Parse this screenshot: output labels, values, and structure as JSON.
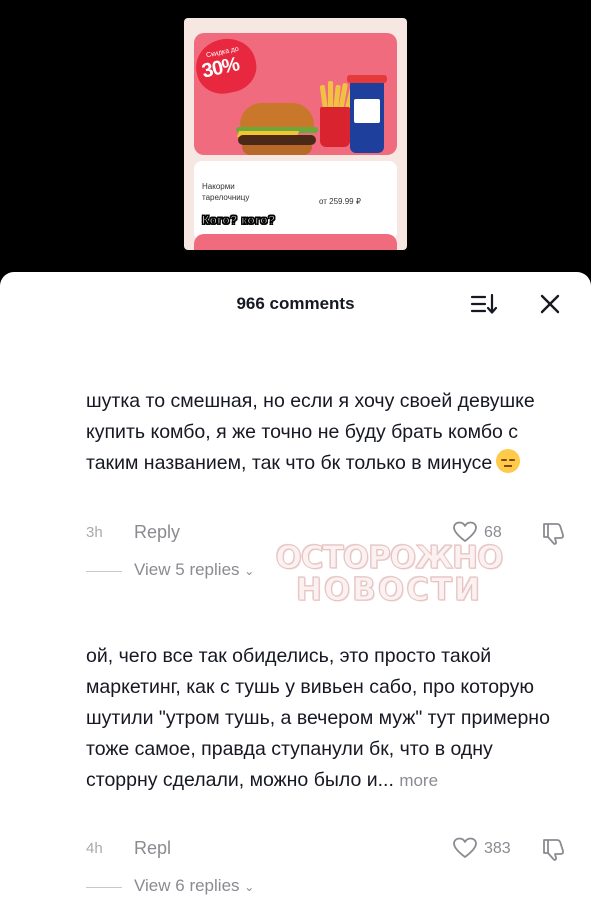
{
  "promo": {
    "discount_label": "Скидка до",
    "discount_value": "30%",
    "product_name": "Накорми тарелочницу",
    "price": "от 259.99 ₽",
    "caption": "Кого? кого?"
  },
  "header": {
    "title": "966 comments"
  },
  "comments": [
    {
      "text": "шутка то смешная, но если я хочу своей девушке купить комбо, я же точно не буду брать комбо с таким названием, так что бк только в минусе",
      "time": "3h",
      "reply_label": "Reply",
      "likes": "68",
      "view_replies": "View 5 replies"
    },
    {
      "text": "ой, чего все так обиделись, это просто такой маркетинг, как с тушь у вивьен сабо, про которую шутили \"утром тушь, а вечером муж\" тут примерно тоже самое, правда ступанули бк, что в одну сторрну сделали, можно было и...",
      "more_label": "more",
      "time": "4h",
      "reply_label": "Repl",
      "likes": "383",
      "view_replies": "View 6 replies"
    }
  ],
  "watermark": {
    "line1": "ОСТОРОЖНО",
    "line2": "НОВОСТИ"
  },
  "colors": {
    "text": "#161823",
    "muted": "#8a8b91",
    "promo_pink": "#f06b7e",
    "promo_red": "#e8283f"
  }
}
